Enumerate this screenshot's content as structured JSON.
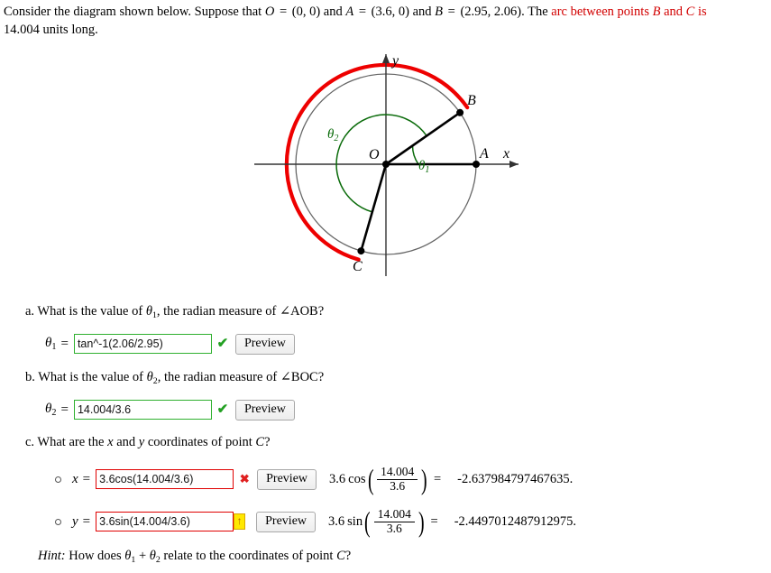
{
  "intro": {
    "part1": "Consider the diagram shown below. Suppose that ",
    "O": "O",
    "eq1": " = ",
    "Oval": "(0, 0)",
    "and1": " and ",
    "A": "A",
    "eq2": " = ",
    "Aval": "(3.6, 0)",
    "and2": " and ",
    "B": "B",
    "eq3": " = ",
    "Bval": "(2.95, 2.06)",
    "part2": ". The ",
    "red_phrase_1": "arc between points ",
    "red_B": "B",
    "red_and": " and ",
    "red_C": "C",
    "red_is": " is",
    "part3": "14.004 units long."
  },
  "diagram": {
    "label_x": "x",
    "label_y": "y",
    "label_O": "O",
    "label_A": "A",
    "label_B": "B",
    "label_C": "C",
    "label_theta1": "θ",
    "label_theta1_sub": "1",
    "label_theta2": "θ",
    "label_theta2_sub": "2",
    "colors": {
      "arc_red": "#ee0000",
      "circle_gray": "#666666",
      "angle_green": "#0a6b0a",
      "axis": "#333333",
      "segment": "#000000"
    }
  },
  "questions": [
    {
      "id": "a",
      "prompt_prefix": "a. What is the value of ",
      "prompt_var": "θ",
      "prompt_var_sub": "1",
      "prompt_suffix": ", the radian measure of ∠AOB?",
      "var_label": "θ",
      "var_sub": "1",
      "equals": "=",
      "value": "tan^-1(2.06/2.95)",
      "placeholder": "",
      "status": "correct",
      "status_glyph": "✔",
      "preview_label": "Preview"
    },
    {
      "id": "b",
      "prompt_prefix": "b. What is the value of ",
      "prompt_var": "θ",
      "prompt_var_sub": "2",
      "prompt_suffix": ", the radian measure of ∠BOC?",
      "var_label": "θ",
      "var_sub": "2",
      "equals": "=",
      "value": "14.004/3.6",
      "placeholder": "",
      "status": "correct",
      "status_glyph": "✔",
      "preview_label": "Preview"
    }
  ],
  "question_c": {
    "prompt": "c. What are the x and y coordinates of point C?",
    "prompt_pre": "c. What are the ",
    "prompt_x": "x",
    "prompt_mid": " and ",
    "prompt_y": "y",
    "prompt_post": " coordinates of point ",
    "prompt_C": "C",
    "prompt_q": "?",
    "rows": [
      {
        "var_label": "x",
        "equals": "=",
        "value": "3.6cos(14.004/3.6)",
        "status": "incorrect",
        "status_glyph": "✖",
        "preview_label": "Preview",
        "expr_coef": "3.6",
        "expr_fn": "cos",
        "expr_num": "14.004",
        "expr_den": "3.6",
        "expr_equals": "=",
        "result": "-2.637984797467635."
      },
      {
        "var_label": "y",
        "equals": "=",
        "value": "3.6sin(14.004/3.6)",
        "status": "pending",
        "status_glyph": "↑",
        "preview_label": "Preview",
        "expr_coef": "3.6",
        "expr_fn": "sin",
        "expr_num": "14.004",
        "expr_den": "3.6",
        "expr_equals": "=",
        "result": "-2.4497012487912975."
      }
    ]
  },
  "hint": {
    "word": "Hint:",
    "text_pre": " How does ",
    "theta1": "θ",
    "theta1_sub": "1",
    "plus": " + ",
    "theta2": "θ",
    "theta2_sub": "2",
    "text_post": " relate to the coordinates of point ",
    "C": "C",
    "q": "?"
  }
}
